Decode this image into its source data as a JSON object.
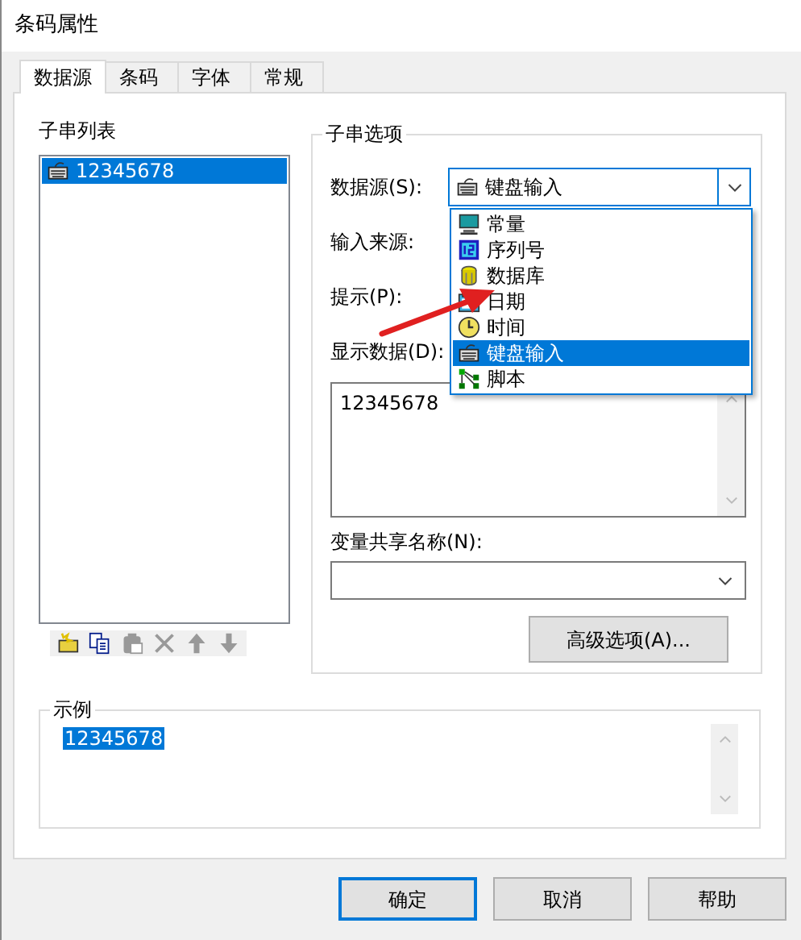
{
  "window": {
    "title": "条码属性"
  },
  "tabs": [
    {
      "label": "数据源",
      "selected": true
    },
    {
      "label": "条码",
      "selected": false
    },
    {
      "label": "字体",
      "selected": false
    },
    {
      "label": "常规",
      "selected": false
    }
  ],
  "substring_list": {
    "label": "子串列表",
    "items": [
      {
        "text": "12345678",
        "selected": true
      }
    ]
  },
  "toolbar": [
    {
      "kind": "new",
      "disabled": false
    },
    {
      "kind": "copy",
      "disabled": false
    },
    {
      "kind": "paste",
      "disabled": true
    },
    {
      "kind": "delete",
      "disabled": true
    },
    {
      "kind": "up",
      "disabled": true
    },
    {
      "kind": "down",
      "disabled": true
    }
  ],
  "substring_options": {
    "label": "子串选项",
    "data_source": {
      "label": "数据源(S):",
      "value": "键盘输入",
      "expanded": true,
      "options": [
        {
          "text": "常量",
          "kind": "constant",
          "selected": false
        },
        {
          "text": "序列号",
          "kind": "serial",
          "selected": false
        },
        {
          "text": "数据库",
          "kind": "database",
          "selected": false
        },
        {
          "text": "日期",
          "kind": "date",
          "selected": false
        },
        {
          "text": "时间",
          "kind": "time",
          "selected": false
        },
        {
          "text": "键盘输入",
          "kind": "keyboard",
          "selected": true
        },
        {
          "text": "脚本",
          "kind": "script",
          "selected": false
        }
      ]
    },
    "input_source": {
      "label": "输入来源:"
    },
    "prompt": {
      "label": "提示(P):"
    },
    "display_data": {
      "label": "显示数据(D):",
      "value": "12345678"
    },
    "shared_variable": {
      "label": "变量共享名称(N):"
    },
    "advanced_button": "高级选项(A)..."
  },
  "example": {
    "label": "示例",
    "text": "12345678"
  },
  "buttons": [
    {
      "label": "确定",
      "default": true
    },
    {
      "label": "取消",
      "default": false
    },
    {
      "label": "帮助",
      "default": false
    }
  ]
}
